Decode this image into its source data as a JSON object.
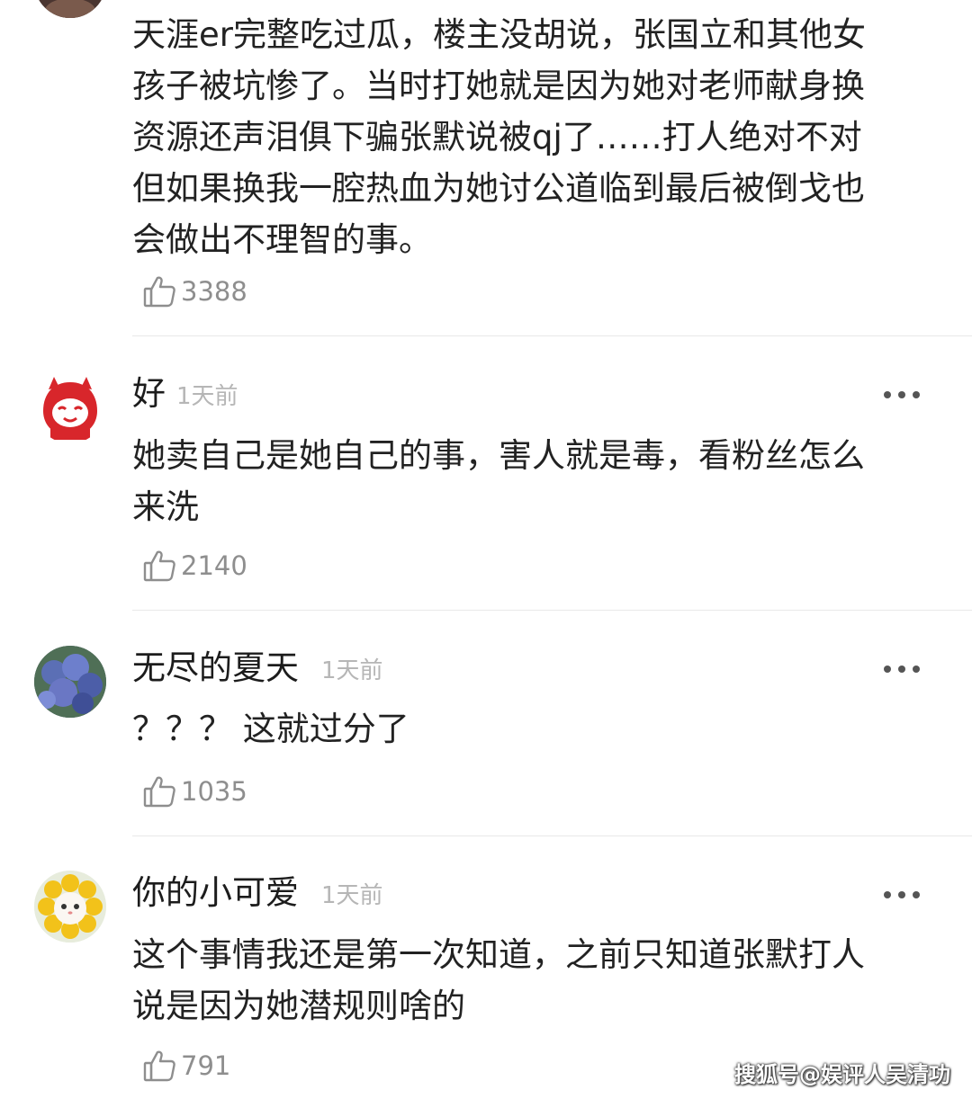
{
  "comments": [
    {
      "username": "",
      "time": "",
      "lines": [
        "天涯er完整吃过瓜，楼主没胡说，张国立和其他女",
        "孩子被坑惨了。当时打她就是因为她对老师献身换",
        "资源还声泪俱下骗张默说被qj了……打人绝对不对",
        "但如果换我一腔热血为她讨公道临到最后被倒戈也",
        "会做出不理智的事。"
      ],
      "likes": "3388"
    },
    {
      "username": "好",
      "time": "1天前",
      "lines": [
        "她卖自己是她自己的事，害人就是毒，看粉丝怎么",
        "来洗"
      ],
      "likes": "2140"
    },
    {
      "username": "无尽的夏天",
      "time": "1天前",
      "lines": [
        "？？？ 这就过分了"
      ],
      "likes": "1035"
    },
    {
      "username": "你的小可爱",
      "time": "1天前",
      "lines": [
        "这个事情我还是第一次知道，之前只知道张默打人",
        "说是因为她潜规则啥的"
      ],
      "likes": "791"
    }
  ],
  "icons": {
    "like": "thumbs-up-icon",
    "more": "more-dots-icon",
    "avatar": "avatar-image"
  },
  "colors": {
    "username": "#1c1c1c",
    "body": "#222222",
    "time": "#b6b6b6",
    "likes": "#8e8e8e",
    "divider": "#e9e9e9"
  },
  "watermark": "搜狐号@娱评人吴清功"
}
